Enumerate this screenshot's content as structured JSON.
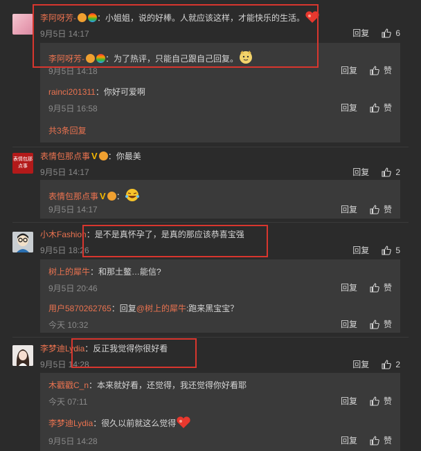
{
  "actions": {
    "reply": "回复",
    "like": "赞"
  },
  "comments": [
    {
      "user": "李阿呀芳-",
      "text": "：小姐姐，说的好棒。人就应该这样，才能快乐的生活。",
      "time": "9月5日 14:17",
      "likes": "6",
      "replies": [
        {
          "user": "李阿呀芳-",
          "text": "：为了热评，只能自己跟自己回复。",
          "time": "9月5日 14:18"
        },
        {
          "user": "rainci201311",
          "text": "：你好可爱啊",
          "time": "9月5日 16:58"
        }
      ],
      "total": "共3条回复"
    },
    {
      "user": "表情包那点事",
      "avatar_text": "表情包那点事",
      "text": "：你最美",
      "time": "9月5日 14:17",
      "likes": "2",
      "replies": [
        {
          "user": "表情包那点事",
          "text": "：",
          "time": "9月5日 14:17"
        }
      ]
    },
    {
      "user": "小木Fashion",
      "text": "：是不是真怀孕了，是真的那应该恭喜宝强",
      "time": "9月5日 18:26",
      "likes": "5",
      "replies": [
        {
          "user": "树上的犀牛",
          "text": "：和那土鳖…能信?",
          "time": "9月5日 20:46"
        },
        {
          "user": "用户5870262765",
          "text_prefix": "：回复",
          "mention": "@树上的犀牛",
          "text": ":跑来黑宝宝？",
          "time": "今天 10:32"
        }
      ]
    },
    {
      "user": "李梦迪Lydia",
      "text": "：反正我觉得你很好看",
      "time": "9月5日 14:28",
      "likes": "2",
      "replies": [
        {
          "user": "木戳戳C_n",
          "text": "：本来就好看，还觉得，我还觉得你好看耶",
          "time": "今天 07:11"
        },
        {
          "user": "李梦迪Lydia",
          "text": "：很久以前就这么觉得",
          "time": "9月5日 14:28"
        }
      ]
    }
  ],
  "colors": {
    "background": "#2b2b2b",
    "reply_box": "#3a3a3a",
    "username": "#eb7350",
    "highlight": "#d9362e"
  }
}
